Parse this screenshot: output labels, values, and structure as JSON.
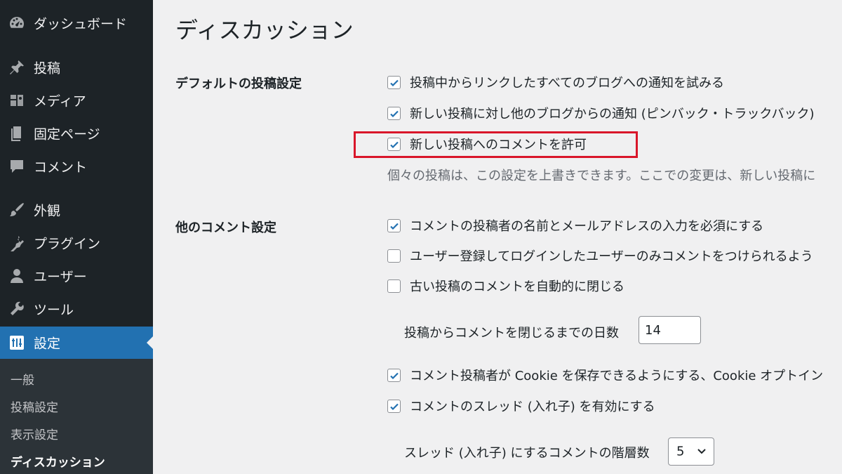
{
  "sidebar": {
    "items": [
      {
        "label": "ダッシュボード",
        "icon": "dashboard-icon"
      },
      {
        "label": "投稿",
        "icon": "pin-icon"
      },
      {
        "label": "メディア",
        "icon": "media-icon"
      },
      {
        "label": "固定ページ",
        "icon": "pages-icon"
      },
      {
        "label": "コメント",
        "icon": "comment-icon"
      },
      {
        "label": "外観",
        "icon": "brush-icon"
      },
      {
        "label": "プラグイン",
        "icon": "plugin-icon"
      },
      {
        "label": "ユーザー",
        "icon": "user-icon"
      },
      {
        "label": "ツール",
        "icon": "wrench-icon"
      },
      {
        "label": "設定",
        "icon": "settings-icon"
      }
    ],
    "submenu": [
      "一般",
      "投稿設定",
      "表示設定",
      "ディスカッション"
    ]
  },
  "page": {
    "title": "ディスカッション"
  },
  "sections": {
    "default_article": {
      "heading": "デフォルトの投稿設定",
      "options": [
        {
          "label": "投稿中からリンクしたすべてのブログへの通知を試みる",
          "checked": true
        },
        {
          "label": "新しい投稿に対し他のブログからの通知 (ピンバック・トラックバック)",
          "checked": true
        },
        {
          "label": "新しい投稿へのコメントを許可",
          "checked": true
        }
      ],
      "description": "個々の投稿は、この設定を上書きできます。ここでの変更は、新しい投稿に"
    },
    "other_comment": {
      "heading": "他のコメント設定",
      "options": [
        {
          "label": "コメントの投稿者の名前とメールアドレスの入力を必須にする",
          "checked": true
        },
        {
          "label": "ユーザー登録してログインしたユーザーのみコメントをつけられるよう",
          "checked": false
        },
        {
          "label": "古い投稿のコメントを自動的に閉じる",
          "checked": false
        },
        {
          "label": "コメント投稿者が Cookie を保存できるようにする、Cookie オプトイン",
          "checked": true
        },
        {
          "label": "コメントのスレッド (入れ子) を有効にする",
          "checked": true
        }
      ],
      "close_days_label": "投稿からコメントを閉じるまでの日数",
      "close_days_value": "14",
      "thread_depth_label": "スレッド (入れ子) にするコメントの階層数",
      "thread_depth_value": "5"
    }
  },
  "colors": {
    "sidebar_bg": "#1d2327",
    "active": "#2271b1",
    "highlight": "#d9162a",
    "check": "#2271b1"
  }
}
